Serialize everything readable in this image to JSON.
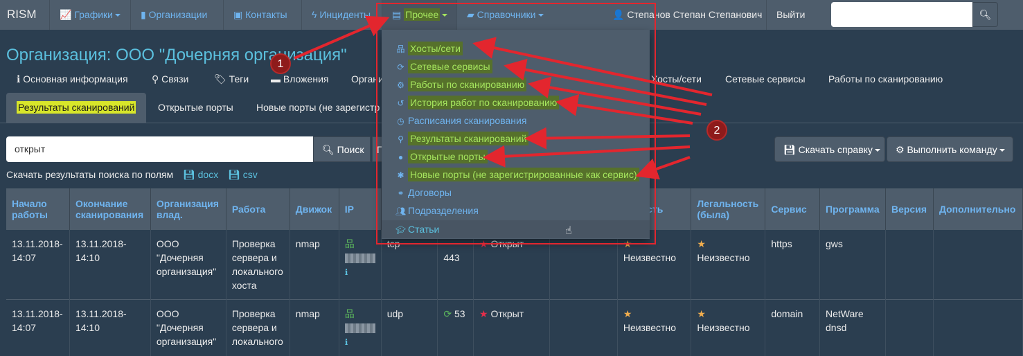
{
  "navbar": {
    "brand": "RISM",
    "items": [
      {
        "label": "Графики",
        "icon": "chart-icon"
      },
      {
        "label": "Организации",
        "icon": "bar-chart-icon"
      },
      {
        "label": "Контакты",
        "icon": "id-card-icon"
      },
      {
        "label": "Инциденты",
        "icon": "bolt-icon"
      },
      {
        "label": "Прочее",
        "icon": "archive-icon"
      },
      {
        "label": "Справочники",
        "icon": "book-icon"
      }
    ],
    "user": "Степанов Степан Степанович",
    "logout": "Выйти",
    "search_value": ""
  },
  "page": {
    "title": "Организация: ООО \"Дочерняя организация\"",
    "tabs_row1": [
      "Основная информация",
      "Связи",
      "Теги",
      "Вложения",
      "Органи",
      "Хосты/сети",
      "Сетевые сервисы",
      "Работы по сканированию"
    ],
    "tabs_row2": [
      "Результаты сканирований",
      "Открытые порты",
      "Новые порты (не зарегистр"
    ],
    "search_value": "открыт",
    "search_button": "Поиск",
    "extra_button": "П",
    "download_button": "Скачать справку",
    "command_button": "Выполнить команду",
    "downloads_label": "Скачать результаты поиска по полям",
    "downloads": [
      "docx",
      "csv"
    ]
  },
  "dropdown": {
    "items": [
      {
        "label": "Хосты/сети",
        "icon": "sitemap-icon",
        "highlight": true
      },
      {
        "label": "Сетевые сервисы",
        "icon": "spinner-icon",
        "highlight": true
      },
      {
        "label": "Работы по сканированию",
        "icon": "gears-icon",
        "highlight": true
      },
      {
        "label": "История работ по сканированию",
        "icon": "history-icon",
        "highlight": true
      },
      {
        "label": "Расписания сканирования",
        "icon": "clock-icon",
        "highlight": false
      },
      {
        "label": "Результаты сканирований",
        "icon": "search-icon",
        "highlight": true
      },
      {
        "label": "Открытые порты",
        "icon": "circle-icon",
        "highlight": true
      },
      {
        "label": "Новые порты (не зарегистрированные как сервис)",
        "icon": "asterisk-icon",
        "highlight": true
      },
      {
        "label": "Договоры",
        "icon": "handshake-icon",
        "highlight": false
      },
      {
        "label": "Подразделения",
        "icon": "users-icon",
        "highlight": false
      },
      {
        "label": "Статьи",
        "icon": "graduation-cap-icon",
        "highlight": false
      }
    ]
  },
  "annotations": {
    "badge1": "1",
    "badge2": "2"
  },
  "table": {
    "headers": [
      "Начало работы",
      "Окончание сканирования",
      "Организация влад.",
      "Работа",
      "Движок",
      "IP",
      "",
      "",
      "",
      "",
      "Легальность",
      "Легальность (была)",
      "Сервис",
      "Программа",
      "Версия",
      "Дополнительно"
    ],
    "header_legal_partial": "льность",
    "rows": [
      {
        "start": "13.11.2018-14:07",
        "end": "13.11.2018-14:10",
        "org": "ООО \"Дочерняя организация\"",
        "work": "Проверка сервера и локального хоста",
        "engine": "nmap",
        "proto": "tcp",
        "port": "443",
        "state": "Открыт",
        "legal": "Неизвестно",
        "legal_was": "Неизвестно",
        "service": "https",
        "program": "gws"
      },
      {
        "start": "13.11.2018-14:07",
        "end": "13.11.2018-14:10",
        "org": "ООО \"Дочерняя организация\"",
        "work": "Проверка сервера и локального",
        "engine": "nmap",
        "proto": "udp",
        "port": "53",
        "state": "Открыт",
        "legal": "Неизвестно",
        "legal_was": "Неизвестно",
        "service": "domain",
        "program": "NetWare dnsd"
      }
    ]
  },
  "colors": {
    "navbar": "#4e5d6c",
    "body": "#2b3e50",
    "accent": "#5bc0de",
    "annotation": "#e3262e",
    "highlight": "#d8e62a"
  }
}
